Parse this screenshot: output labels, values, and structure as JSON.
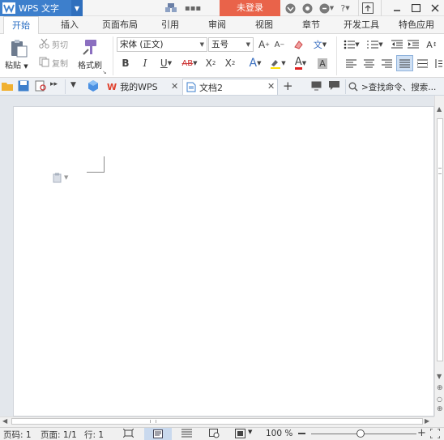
{
  "app": {
    "name": "WPS 文字",
    "login_label": "未登录"
  },
  "ribbon_tabs": [
    "开始",
    "插入",
    "页面布局",
    "引用",
    "审阅",
    "视图",
    "章节",
    "开发工具",
    "特色应用"
  ],
  "clipboard": {
    "paste": "粘贴",
    "cut": "剪切",
    "copy": "复制",
    "format_painter": "格式刷"
  },
  "font": {
    "name": "宋体 (正文)",
    "size": "五号"
  },
  "doc_tabs": {
    "my_wps": "我的WPS",
    "doc": "文档2"
  },
  "search": {
    "label": ">查找命令、搜索..."
  },
  "status": {
    "page_code": "页码: 1",
    "page": "页面: 1/1",
    "row": "行: 1",
    "zoom": "100 %"
  },
  "colors": {
    "accent": "#3d7fcc",
    "login": "#e9634a",
    "wps_red": "#e0402c"
  },
  "icons": [
    "wps-logo-icon",
    "paste-icon",
    "scissors-icon",
    "copy-icon",
    "format-painter-icon",
    "bold-icon",
    "italic-icon",
    "underline-icon",
    "strikethrough-icon",
    "superscript-icon",
    "subscript-icon",
    "font-color-icon",
    "highlight-icon",
    "bullets-icon",
    "numbering-icon",
    "indent-icon",
    "align-left-icon",
    "align-center-icon",
    "align-right-icon",
    "justify-icon",
    "open-icon",
    "save-icon",
    "print-icon",
    "search-icon"
  ]
}
